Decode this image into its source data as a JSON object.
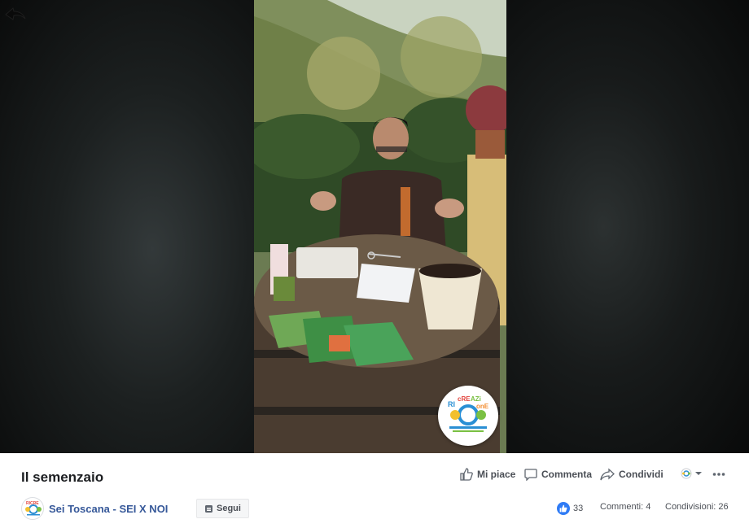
{
  "video": {
    "badge_text": "RICREAZIONE"
  },
  "post": {
    "title": "Il semenzaio"
  },
  "actions": {
    "like": "Mi piace",
    "comment": "Commenta",
    "share": "Condividi"
  },
  "page": {
    "name": "Sei Toscana - SEI X NOI",
    "follow": "Segui"
  },
  "stats": {
    "likes": "33",
    "comments": "Commenti: 4",
    "shares": "Condivisioni: 26"
  },
  "colors": {
    "link": "#365899",
    "like_blue": "#2f7bf5"
  },
  "icons": {
    "back": "back-arrow-icon",
    "like": "thumbs-up-icon",
    "comment": "speech-bubble-icon",
    "share": "share-arrow-icon",
    "audience": "page-avatar-dropdown-icon",
    "more": "more-dots-icon",
    "follow": "follow-icon"
  }
}
